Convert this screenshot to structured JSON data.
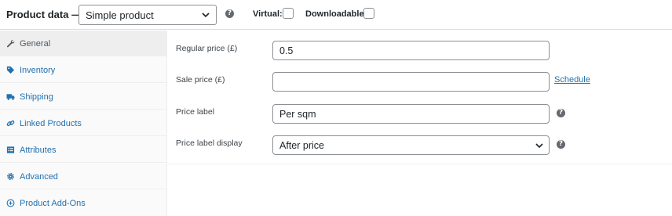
{
  "header": {
    "title": "Product data —",
    "product_type": "Simple product",
    "virtual_label": "Virtual:",
    "downloadable_label": "Downloadable:",
    "help_glyph": "?"
  },
  "sidebar": {
    "items": [
      {
        "label": "General",
        "icon": "wrench-icon"
      },
      {
        "label": "Inventory",
        "icon": "tag-icon"
      },
      {
        "label": "Shipping",
        "icon": "truck-icon"
      },
      {
        "label": "Linked Products",
        "icon": "link-icon"
      },
      {
        "label": "Attributes",
        "icon": "list-icon"
      },
      {
        "label": "Advanced",
        "icon": "gear-icon"
      },
      {
        "label": "Product Add-Ons",
        "icon": "plus-circle-icon"
      }
    ]
  },
  "fields": {
    "regular_price": {
      "label": "Regular price (£)",
      "value": "0.5"
    },
    "sale_price": {
      "label": "Sale price (£)",
      "value": "",
      "schedule_link": "Schedule"
    },
    "price_label": {
      "label": "Price label",
      "value": "Per sqm"
    },
    "price_label_display": {
      "label": "Price label display",
      "value": "After price"
    }
  },
  "colors": {
    "link": "#2271b1",
    "active_tab_bg": "#eeeeee",
    "border": "#8c8f94"
  }
}
